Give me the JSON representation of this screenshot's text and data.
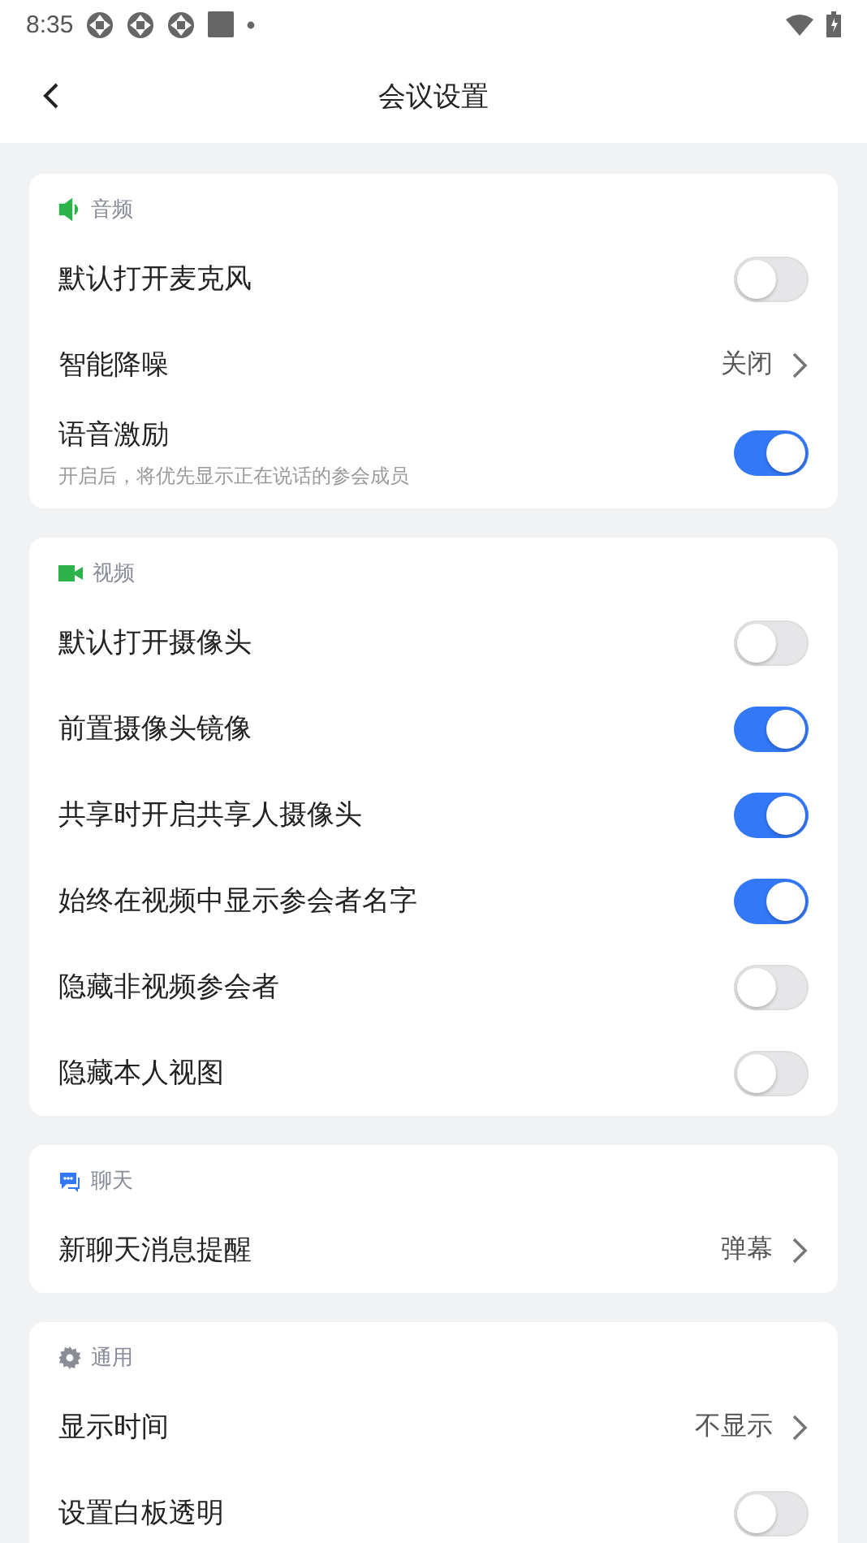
{
  "status_bar": {
    "time": "8:35"
  },
  "header": {
    "title": "会议设置"
  },
  "sections": [
    {
      "kind": "audio",
      "title": "音频",
      "items": [
        {
          "kind": "toggle",
          "label": "默认打开麦克风",
          "on": false
        },
        {
          "kind": "value",
          "label": "智能降噪",
          "value": "关闭"
        },
        {
          "kind": "toggle",
          "label": "语音激励",
          "on": true,
          "description": "开启后，将优先显示正在说话的参会成员"
        }
      ]
    },
    {
      "kind": "video",
      "title": "视频",
      "items": [
        {
          "kind": "toggle",
          "label": "默认打开摄像头",
          "on": false
        },
        {
          "kind": "toggle",
          "label": "前置摄像头镜像",
          "on": true
        },
        {
          "kind": "toggle",
          "label": "共享时开启共享人摄像头",
          "on": true
        },
        {
          "kind": "toggle",
          "label": "始终在视频中显示参会者名字",
          "on": true
        },
        {
          "kind": "toggle",
          "label": "隐藏非视频参会者",
          "on": false
        },
        {
          "kind": "toggle",
          "label": "隐藏本人视图",
          "on": false
        }
      ]
    },
    {
      "kind": "chat",
      "title": "聊天",
      "items": [
        {
          "kind": "value",
          "label": "新聊天消息提醒",
          "value": "弹幕"
        }
      ]
    },
    {
      "kind": "general",
      "title": "通用",
      "items": [
        {
          "kind": "value",
          "label": "显示时间",
          "value": "不显示"
        },
        {
          "kind": "toggle",
          "label": "设置白板透明",
          "on": false
        }
      ]
    }
  ]
}
